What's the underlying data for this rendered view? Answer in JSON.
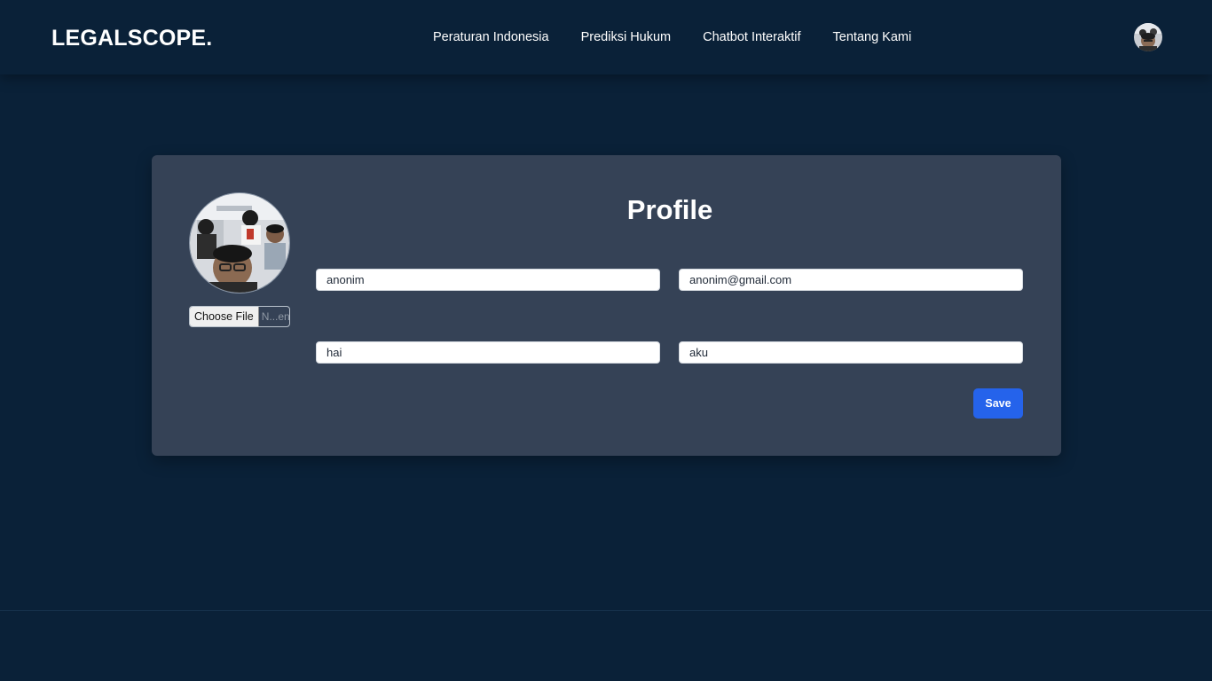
{
  "header": {
    "brand": "LEGALSCOPE.",
    "nav": [
      {
        "label": "Peraturan Indonesia"
      },
      {
        "label": "Prediksi Hukum"
      },
      {
        "label": "Chatbot Interaktif"
      },
      {
        "label": "Tentang Kami"
      }
    ]
  },
  "profile": {
    "title": "Profile",
    "file_button": "Choose File",
    "file_status": "N...en",
    "fields": {
      "name": "anonim",
      "email": "anonim@gmail.com",
      "field_3": "hai",
      "field_4": "aku"
    },
    "save_label": "Save"
  },
  "colors": {
    "background": "#0a2138",
    "card": "#354256",
    "accent": "#2563eb"
  }
}
